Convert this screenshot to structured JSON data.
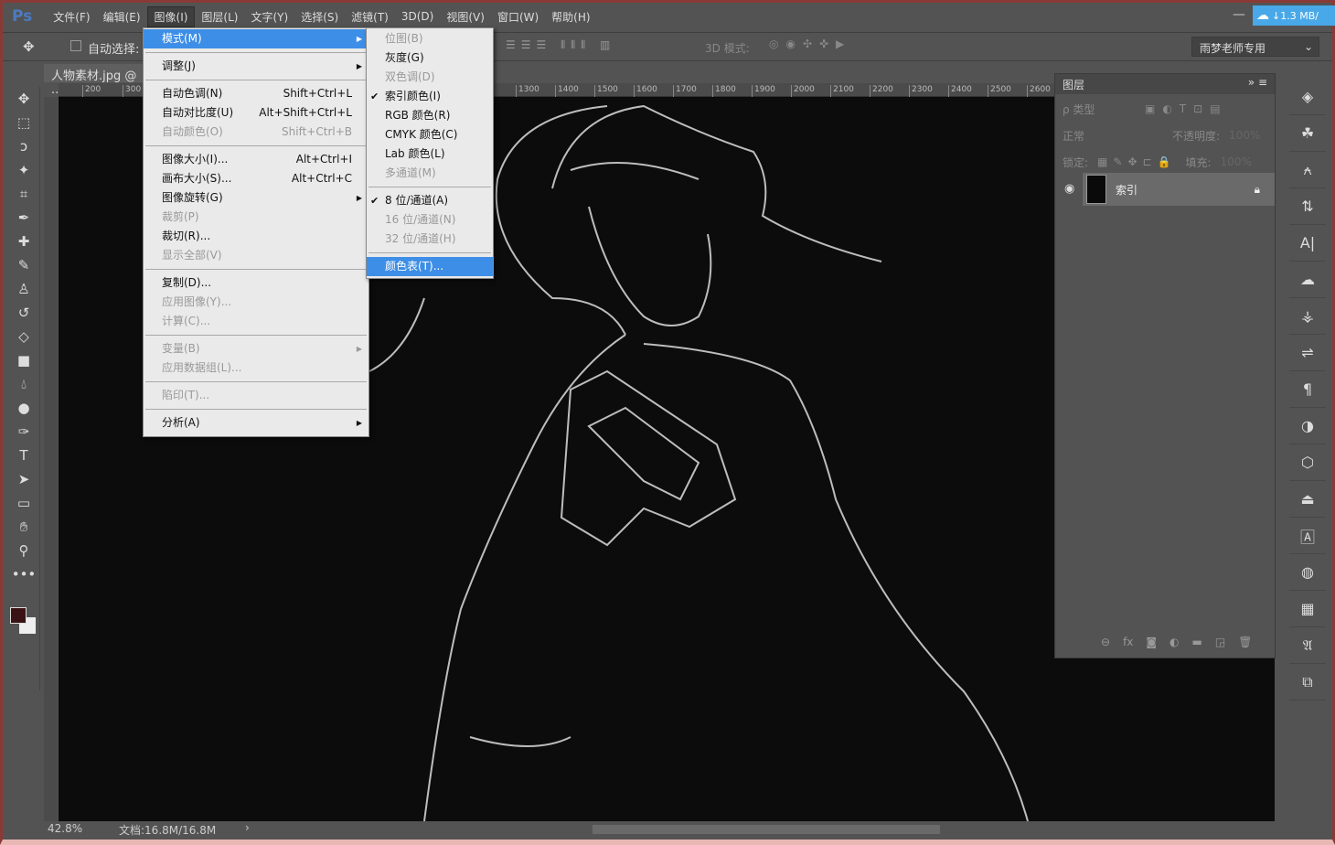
{
  "app": {
    "logo": "Ps",
    "netdisk": "↓1.3 MB/",
    "minimize": "—"
  },
  "menubar": [
    "文件(F)",
    "编辑(E)",
    "图像(I)",
    "图层(L)",
    "文字(Y)",
    "选择(S)",
    "滤镜(T)",
    "3D(D)",
    "视图(V)",
    "窗口(W)",
    "帮助(H)"
  ],
  "options": {
    "auto_select": "自动选择:",
    "mode_3d": "3D 模式:",
    "workspace": "雨梦老师专用"
  },
  "document": {
    "tab": "人物素材.jpg @ ...",
    "ruler_ticks": [
      "200",
      "300",
      "1300",
      "1400",
      "1500",
      "1600",
      "1700",
      "1800",
      "1900",
      "2000",
      "2100",
      "2200",
      "2300",
      "2400",
      "2500",
      "2600"
    ]
  },
  "status": {
    "zoom": "42.8%",
    "doc": "文档:16.8M/16.8M"
  },
  "image_menu": [
    {
      "label": "模式(M)",
      "submenu": true,
      "highlighted": true
    },
    {
      "sep": true
    },
    {
      "label": "调整(J)",
      "submenu": true
    },
    {
      "sep": true
    },
    {
      "label": "自动色调(N)",
      "shortcut": "Shift+Ctrl+L"
    },
    {
      "label": "自动对比度(U)",
      "shortcut": "Alt+Shift+Ctrl+L"
    },
    {
      "label": "自动颜色(O)",
      "shortcut": "Shift+Ctrl+B",
      "disabled": true
    },
    {
      "sep": true
    },
    {
      "label": "图像大小(I)...",
      "shortcut": "Alt+Ctrl+I"
    },
    {
      "label": "画布大小(S)...",
      "shortcut": "Alt+Ctrl+C"
    },
    {
      "label": "图像旋转(G)",
      "submenu": true
    },
    {
      "label": "裁剪(P)",
      "disabled": true
    },
    {
      "label": "裁切(R)..."
    },
    {
      "label": "显示全部(V)",
      "disabled": true
    },
    {
      "sep": true
    },
    {
      "label": "复制(D)..."
    },
    {
      "label": "应用图像(Y)...",
      "disabled": true
    },
    {
      "label": "计算(C)...",
      "disabled": true
    },
    {
      "sep": true
    },
    {
      "label": "变量(B)",
      "submenu": true,
      "disabled": true
    },
    {
      "label": "应用数据组(L)...",
      "disabled": true
    },
    {
      "sep": true
    },
    {
      "label": "陷印(T)...",
      "disabled": true
    },
    {
      "sep": true
    },
    {
      "label": "分析(A)",
      "submenu": true
    }
  ],
  "mode_submenu": [
    {
      "label": "位图(B)",
      "disabled": true
    },
    {
      "label": "灰度(G)"
    },
    {
      "label": "双色调(D)",
      "disabled": true
    },
    {
      "label": "索引颜色(I)",
      "checked": true
    },
    {
      "label": "RGB 颜色(R)"
    },
    {
      "label": "CMYK 颜色(C)"
    },
    {
      "label": "Lab 颜色(L)"
    },
    {
      "label": "多通道(M)",
      "disabled": true
    },
    {
      "sep": true
    },
    {
      "label": "8 位/通道(A)",
      "checked": true
    },
    {
      "label": "16 位/通道(N)",
      "disabled": true
    },
    {
      "label": "32 位/通道(H)",
      "disabled": true
    },
    {
      "sep": true
    },
    {
      "label": "颜色表(T)...",
      "highlighted": true
    }
  ],
  "layers_panel": {
    "title": "图层",
    "filter": "ρ 类型",
    "blend": "正常",
    "opacity_label": "不透明度:",
    "opacity": "100%",
    "lock_label": "锁定:",
    "fill_label": "填充:",
    "fill": "100%",
    "layer_name": "索引"
  },
  "colors": {
    "highlight": "#3d8ee6",
    "foreground": "#3a1414",
    "background": "#eeeeee"
  }
}
